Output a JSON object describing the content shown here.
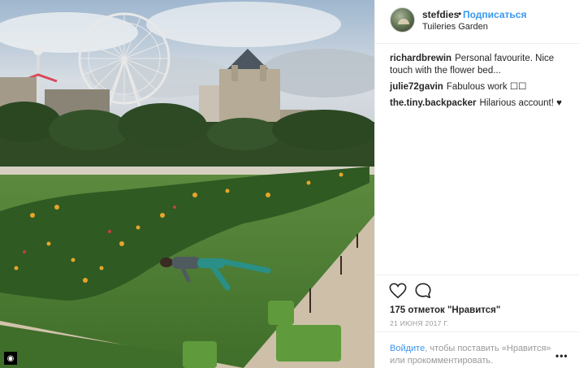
{
  "photo": {
    "badge_icon": "instagram-logo-icon"
  },
  "post": {
    "username": "stefdies",
    "dot": "•",
    "follow_label": "Подписаться",
    "location": "Tuileries Garden"
  },
  "comments": [
    {
      "author": "richardbrewin",
      "text": "Personal favourite. Nice touch with the flower bed..."
    },
    {
      "author": "julie72gavin",
      "text": "Fabulous work ☐☐"
    },
    {
      "author": "the.tiny.backpacker",
      "text": "Hilarious account! ♥"
    }
  ],
  "actions": {
    "like_icon": "heart-icon",
    "comment_icon": "comment-bubble-icon",
    "likes_text": "175 отметок \"Нравится\"",
    "date": "21 ИЮНЯ 2017 Г."
  },
  "login": {
    "link_text": "Войдите",
    "rest_text": ", чтобы поставить «Нравится» или прокомментировать.",
    "more_label": "•••"
  },
  "colors": {
    "accent": "#3897f0",
    "text": "#262626",
    "muted": "#999999",
    "border": "#efefef"
  }
}
